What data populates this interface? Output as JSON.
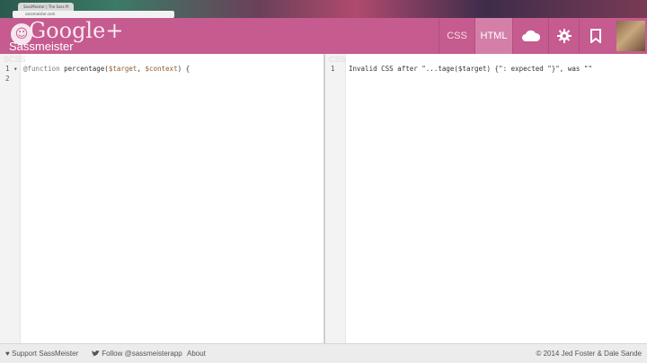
{
  "browser": {
    "tab_title": "SassMeister | The Sass Pl",
    "url": "sassmeister.com"
  },
  "header": {
    "overlay_text": "Google+",
    "logo_text": "Sass",
    "logo_suffix": "meister",
    "nav": {
      "css_label": "CSS",
      "html_label": "HTML"
    },
    "icons": [
      "cloud-icon",
      "gear-icon",
      "bookmark-icon"
    ],
    "accent_color": "#c55b8f"
  },
  "editor_left": {
    "label": "SCSS",
    "lines": [
      {
        "num": "1",
        "fold": "▾",
        "parts": [
          {
            "t": "@function",
            "c": "k"
          },
          {
            "t": " percentage(",
            "c": "n"
          },
          {
            "t": "$target",
            "c": "v"
          },
          {
            "t": ", ",
            "c": "n"
          },
          {
            "t": "$context",
            "c": "v"
          },
          {
            "t": ") {",
            "c": "n"
          }
        ]
      },
      {
        "num": "2",
        "fold": "",
        "parts": []
      }
    ]
  },
  "editor_right": {
    "label": "CSS",
    "lines": [
      {
        "num": "1",
        "text": "Invalid CSS after \"...tage($target) {\": expected \"}\", was \"\""
      }
    ]
  },
  "footer": {
    "support": "Support SassMeister",
    "follow": "Follow @sassmeisterapp",
    "about": "About",
    "copyright": "© 2014 Jed Foster & Dale Sande"
  }
}
